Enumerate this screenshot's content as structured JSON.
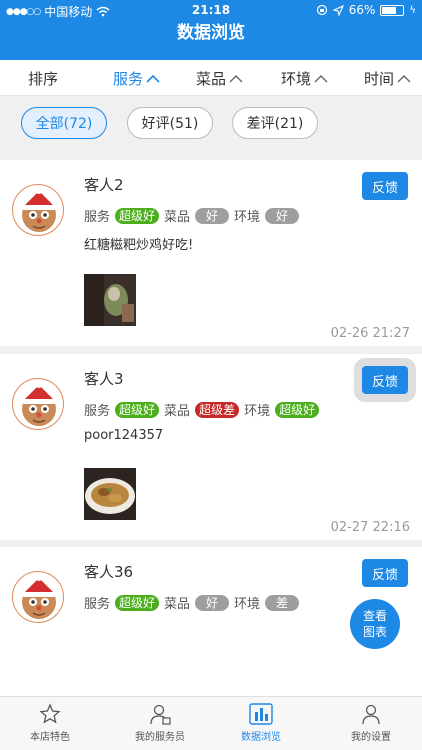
{
  "status": {
    "carrier": "中国移动",
    "time": "21:18",
    "battery": "66%",
    "battery_level": 0.66
  },
  "title": "数据浏览",
  "sort_bar": {
    "label": "排序",
    "items": [
      {
        "label": "服务",
        "icon": "chevron-up-icon",
        "active": true
      },
      {
        "label": "菜品",
        "icon": "chevron-up-icon",
        "active": false
      },
      {
        "label": "环境",
        "icon": "chevron-up-icon",
        "active": false
      },
      {
        "label": "时间",
        "icon": "chevron-up-icon",
        "active": false
      }
    ]
  },
  "filters": [
    {
      "label": "全部(72)",
      "active": true
    },
    {
      "label": "好评(51)",
      "active": false
    },
    {
      "label": "差评(21)",
      "active": false
    }
  ],
  "reviews": [
    {
      "name": "客人2",
      "ratings": [
        {
          "label": "服务",
          "value": "超级好"
        },
        {
          "label": "菜品",
          "value": "好"
        },
        {
          "label": "环境",
          "value": "好"
        }
      ],
      "comment": "红糖糍粑炒鸡好吃!",
      "time": "02-26 21:27",
      "feedback": "反馈"
    },
    {
      "name": "客人3",
      "ratings": [
        {
          "label": "服务",
          "value": "超级好"
        },
        {
          "label": "菜品",
          "value": "超级差"
        },
        {
          "label": "环境",
          "value": "超级好"
        }
      ],
      "comment": "poor124357",
      "time": "02-27 22:16",
      "feedback": "反馈"
    },
    {
      "name": "客人36",
      "ratings": [
        {
          "label": "服务",
          "value": "超级好"
        },
        {
          "label": "菜品",
          "value": "好"
        },
        {
          "label": "环境",
          "value": "差"
        }
      ],
      "feedback": "反馈"
    }
  ],
  "fab": {
    "line1": "查看",
    "line2": "图表"
  },
  "tabs": [
    {
      "label": "本店特色",
      "icon": "star-icon",
      "active": false
    },
    {
      "label": "我的服务员",
      "icon": "waiter-icon",
      "active": false
    },
    {
      "label": "数据浏览",
      "icon": "bar-chart-icon",
      "active": true
    },
    {
      "label": "我的设置",
      "icon": "person-icon",
      "active": false
    }
  ],
  "colors": {
    "primary": "#1e88e5",
    "badge_good": "#4cae1c",
    "badge_bad": "#c62828",
    "badge_neutral": "#9e9e9e"
  }
}
